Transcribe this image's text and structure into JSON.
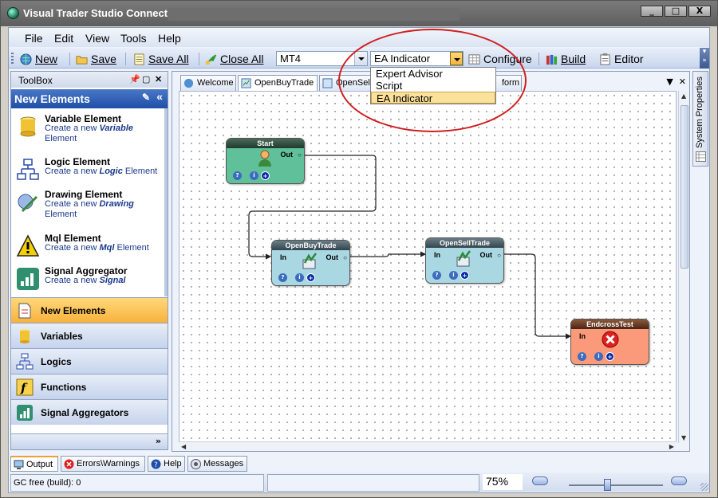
{
  "window": {
    "title": "Visual Trader Studio Connect",
    "controls": [
      "_",
      "□",
      "X"
    ]
  },
  "menu": [
    "File",
    "Edit",
    "View",
    "Tools",
    "Help"
  ],
  "toolbar": {
    "new": "New",
    "save": "Save",
    "save_all": "Save All",
    "close_all": "Close All",
    "platform_value": "MT4",
    "type_value": "EA Indicator",
    "configure": "Configure",
    "build": "Build",
    "editor": "Editor"
  },
  "type_dropdown": {
    "options": [
      "Expert Advisor",
      "Script",
      "EA Indicator"
    ],
    "selected": "EA Indicator"
  },
  "toolbox": {
    "title": "ToolBox",
    "section": "New Elements",
    "elements": [
      {
        "title": "Variable Element",
        "pre": "Create a new ",
        "kw": "Variable",
        "post": " Element"
      },
      {
        "title": "Logic Element",
        "pre": "Create a new ",
        "kw": "Logic",
        "post": " Element"
      },
      {
        "title": "Drawing Element",
        "pre": "Create a new ",
        "kw": "Drawing",
        "post": " Element"
      },
      {
        "title": "Mql Element",
        "pre": "Create a new ",
        "kw": "Mql",
        "post": " Element"
      },
      {
        "title": "Signal Aggregator",
        "pre": "Create a new ",
        "kw": "Signal",
        "post": ""
      }
    ],
    "groups": [
      "New Elements",
      "Variables",
      "Logics",
      "Functions",
      "Signal Aggregators"
    ],
    "selected_group": "New Elements"
  },
  "doc_tabs": [
    "Welcome",
    "OpenBuyTrade",
    "OpenSell",
    "form"
  ],
  "nodes": {
    "start": {
      "title": "Start",
      "out": "Out"
    },
    "openbuy": {
      "title": "OpenBuyTrade",
      "in": "In",
      "out": "Out"
    },
    "opensell": {
      "title": "OpenSellTrade",
      "in": "In",
      "out": "Out"
    },
    "endcross": {
      "title": "EndcrossTest",
      "in": "In"
    }
  },
  "side_panel": "System Properties",
  "bottom_tabs": [
    "Output",
    "Errors\\Warnings",
    "Help",
    "Messages"
  ],
  "status": {
    "gc": "GC free (build): 0",
    "zoom": "75%",
    "zoom_fraction": 0.4
  },
  "colors": {
    "start": "#5fc09a",
    "trade": "#a9d7e2",
    "end": "#fb9a7a",
    "highlight": "#d01f1f"
  }
}
